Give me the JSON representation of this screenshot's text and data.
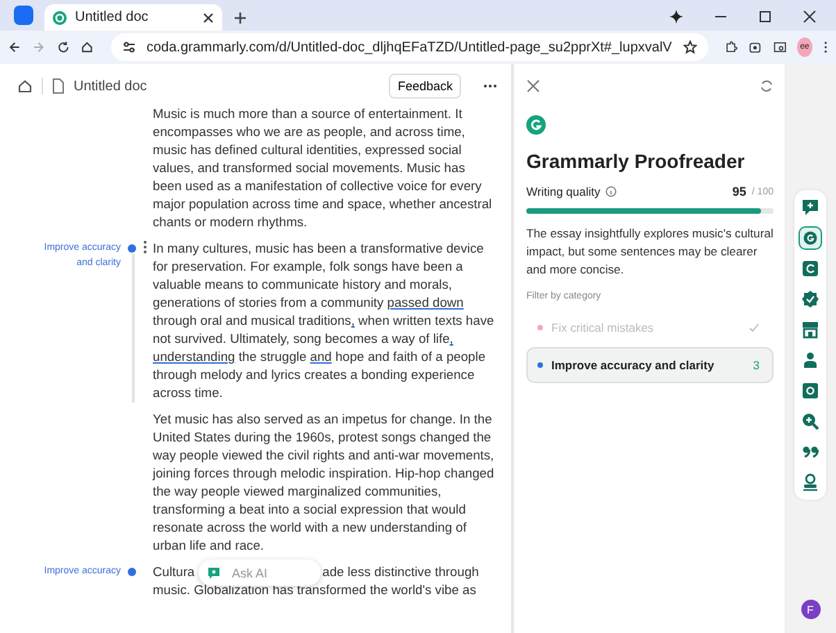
{
  "browser": {
    "tab": {
      "title": "Untitled doc",
      "selected": true
    },
    "url": "coda.grammarly.com/d/Untitled-doc_dljhqEFaTZD/Untitled-page_su2pprXt#_lupxvalV",
    "profile": "ee"
  },
  "doc": {
    "title": "Untitled doc",
    "feedback_button": "Feedback",
    "paragraphs": [
      {
        "active": false,
        "segments": [
          {
            "text": "Music is much more than a source of entertainment. It encompasses who we are as people, and across time, music has defined cultural identities, expressed social values, and transformed social movements. Music has been used as a manifestation of collective voice for every major population across time and space, whether ancestral chants or modern rhythms.",
            "flagged": false
          }
        ]
      },
      {
        "annotation": "Improve accuracy and clarity",
        "active": true,
        "segments": [
          {
            "text": "In many cultures, music has been a transformative device for preservation. For example, folk songs have been a valuable means to communicate history and morals, generations of stories from a community ",
            "flagged": false
          },
          {
            "text": "passed down",
            "flagged": true
          },
          {
            "text": " through oral and musical traditions",
            "flagged": false
          },
          {
            "text": ",",
            "flagged": true
          },
          {
            "text": " when written texts have not survived. Ultimately, song becomes a way of life",
            "flagged": false
          },
          {
            "text": ",",
            "flagged": true
          },
          {
            "text": " understanding",
            "flagged": true
          },
          {
            "text": " the struggle ",
            "flagged": false
          },
          {
            "text": "and",
            "flagged": true
          },
          {
            "text": " hope and faith of a people through melody and lyrics creates a bonding experience across time.",
            "flagged": false
          }
        ]
      },
      {
        "active": false,
        "segments": [
          {
            "text": "Yet music has also served as an impetus for change. In the United States during the 1960s, protest songs changed the way people viewed the civil rights and anti-war movements, joining forces through melodic inspiration. Hip-hop changed the way people viewed marginalized communities, transforming a beat into a social expression that would resonate across the world with a new understanding of urban life and race.",
            "flagged": false
          }
        ]
      },
      {
        "annotation": "Improve accuracy",
        "active": false,
        "covered": true,
        "segments": [
          {
            "text": "Cultura",
            "flagged": false
          },
          {
            "text": "ade less distinctive through",
            "flagged": false
          },
          {
            "text": "music. Globalization has transformed the world's vibe as",
            "flagged": false
          }
        ]
      }
    ],
    "ask_ai": "Ask AI"
  },
  "panel": {
    "title": "Grammarly Proofreader",
    "quality_label": "Writing quality",
    "score": "95",
    "score_max": "/ 100",
    "level": 0.95,
    "summary": "The essay insightfully explores music's cultural impact, but some sentences may be clearer and more concise.",
    "filter_label": "Filter by category",
    "categories": [
      {
        "label": "Fix critical mistakes",
        "color": "#f4a9b8",
        "selected": false,
        "done": true
      },
      {
        "label": "Improve accuracy and clarity",
        "color": "#2f6fe0",
        "selected": true,
        "done": false,
        "count": "3"
      }
    ]
  },
  "rail": {
    "tools": [
      {
        "kind": "comment",
        "selected": false
      },
      {
        "kind": "grammarly",
        "selected": true
      },
      {
        "kind": "rewrite",
        "selected": false
      },
      {
        "kind": "badge",
        "selected": false
      },
      {
        "kind": "store",
        "selected": false
      },
      {
        "kind": "person",
        "selected": false
      },
      {
        "kind": "frame",
        "selected": false
      },
      {
        "kind": "zoom",
        "selected": false
      },
      {
        "kind": "quote",
        "selected": false
      },
      {
        "kind": "stamp",
        "selected": false
      }
    ],
    "user_initial": "F"
  }
}
